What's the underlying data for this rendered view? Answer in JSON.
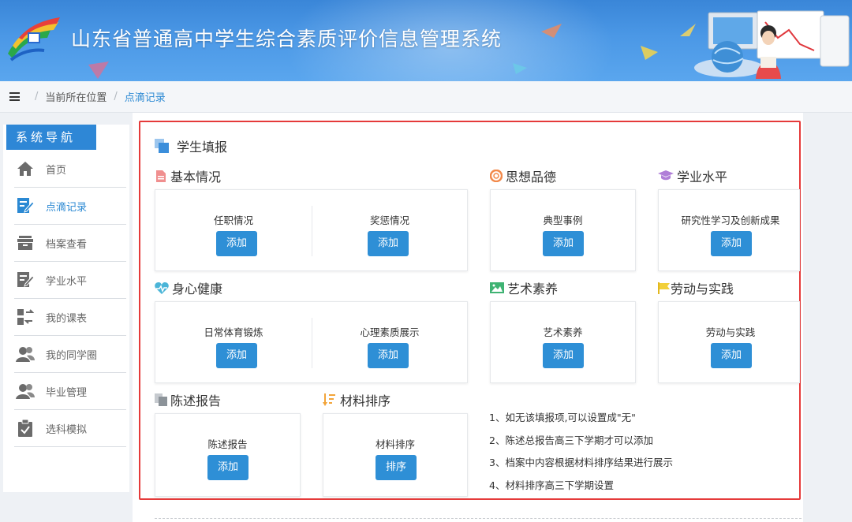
{
  "header": {
    "title": "山东省普通高中学生综合素质评价信息管理系统"
  },
  "breadcrumb": {
    "here": "当前所在位置",
    "current": "点滴记录"
  },
  "sidebar": {
    "heading": "系统导航",
    "items": [
      {
        "label": "首页",
        "icon": "home-icon"
      },
      {
        "label": "点滴记录",
        "icon": "edit-record-icon",
        "active": true
      },
      {
        "label": "档案查看",
        "icon": "archive-icon"
      },
      {
        "label": "学业水平",
        "icon": "edit-icon"
      },
      {
        "label": "我的课表",
        "icon": "timetable-icon"
      },
      {
        "label": "我的同学圈",
        "icon": "classmates-icon"
      },
      {
        "label": "毕业管理",
        "icon": "graduation-icon"
      },
      {
        "label": "选科模拟",
        "icon": "checklist-icon"
      }
    ]
  },
  "panel": {
    "title": "学生填报"
  },
  "sections": {
    "basic": {
      "title": "基本情况",
      "items": [
        {
          "label": "任职情况",
          "button": "添加"
        },
        {
          "label": "奖惩情况",
          "button": "添加"
        }
      ]
    },
    "morality": {
      "title": "思想品德",
      "items": [
        {
          "label": "典型事例",
          "button": "添加"
        }
      ]
    },
    "academic": {
      "title": "学业水平",
      "items": [
        {
          "label": "研究性学习及创新成果",
          "button": "添加"
        }
      ]
    },
    "health": {
      "title": "身心健康",
      "items": [
        {
          "label": "日常体育锻炼",
          "button": "添加"
        },
        {
          "label": "心理素质展示",
          "button": "添加"
        }
      ]
    },
    "art": {
      "title": "艺术素养",
      "items": [
        {
          "label": "艺术素养",
          "button": "添加"
        }
      ]
    },
    "labor": {
      "title": "劳动与实践",
      "items": [
        {
          "label": "劳动与实践",
          "button": "添加"
        }
      ]
    },
    "report": {
      "title": "陈述报告",
      "items": [
        {
          "label": "陈述报告",
          "button": "添加"
        }
      ]
    },
    "sort": {
      "title": "材料排序",
      "items": [
        {
          "label": "材料排序",
          "button": "排序"
        }
      ]
    }
  },
  "notes": [
    "1、如无该填报项,可以设置成\"无\"",
    "2、陈述总报告高三下学期才可以添加",
    "3、档案中内容根据材料排序结果进行展示",
    "4、材料排序高三下学期设置"
  ],
  "colors": {
    "header_blue": "#4b98e6",
    "button_blue": "#2e8fd6",
    "highlight_red": "#e53a3a",
    "nav_blue": "#2e87d6"
  }
}
